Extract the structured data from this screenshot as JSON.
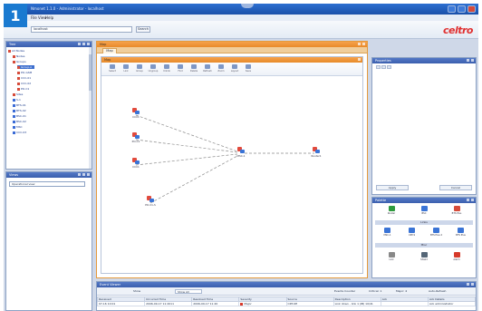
{
  "step_badge": "1",
  "app": {
    "title": "Nmonet 1.1.0 - Administrator - localhost"
  },
  "menu": [
    "File",
    "View",
    "Help"
  ],
  "toolbar": {
    "session_value": "localhost",
    "go_label": "Search",
    "brand": "celtro"
  },
  "left_tree": {
    "title": "Tree",
    "items": [
      {
        "label": "All Nodes",
        "level": 0,
        "icon": "folder-icon"
      },
      {
        "label": "Nodes",
        "level": 1,
        "icon": "folder-icon"
      },
      {
        "label": "Groups",
        "level": 1,
        "icon": "folder-icon"
      },
      {
        "label": "Group-A",
        "level": 2,
        "icon": "node-icon"
      },
      {
        "label": "PO-GSM",
        "level": 2,
        "icon": "node-icon"
      },
      {
        "label": "CCC-01",
        "level": 2,
        "icon": "node-icon"
      },
      {
        "label": "CCC-02",
        "level": 2,
        "icon": "node-icon"
      },
      {
        "label": "PO-C1",
        "level": 2,
        "icon": "node-icon"
      },
      {
        "label": "Sites",
        "level": 1,
        "icon": "folder-icon"
      },
      {
        "label": "S-1",
        "level": 1,
        "icon": "node-icon"
      },
      {
        "label": "BTS-01",
        "level": 1,
        "icon": "node-icon"
      },
      {
        "label": "BTS-02",
        "level": 1,
        "icon": "node-icon"
      },
      {
        "label": "BSC-01",
        "level": 1,
        "icon": "node-icon"
      },
      {
        "label": "BSC-02",
        "level": 1,
        "icon": "node-icon"
      },
      {
        "label": "MSC",
        "level": 1,
        "icon": "node-icon"
      },
      {
        "label": "CCC-03",
        "level": 1,
        "icon": "node-icon"
      }
    ]
  },
  "views_panel": {
    "title": "Views",
    "selected": "Operational view"
  },
  "map_panel": {
    "title": "Map",
    "tab": "Map",
    "inner_title": "Map",
    "tools": [
      "Select",
      "Link",
      "Group",
      "Ungroup",
      "Unlink",
      "Find",
      "Delete",
      "Refresh",
      "Zoom",
      "Layout",
      "Save"
    ]
  },
  "topology": {
    "nodes": [
      {
        "id": "n1",
        "label": "CCC1"
      },
      {
        "id": "n2",
        "label": "PO-C1"
      },
      {
        "id": "n3",
        "label": "CCC1"
      },
      {
        "id": "n4",
        "label": "PO-C1-S"
      },
      {
        "id": "hub",
        "label": "MSC-1"
      },
      {
        "id": "sw",
        "label": "Router1"
      }
    ],
    "links": [
      [
        "n1",
        "hub"
      ],
      [
        "n2",
        "hub"
      ],
      [
        "n3",
        "hub"
      ],
      [
        "n4",
        "hub"
      ],
      [
        "hub",
        "sw"
      ]
    ]
  },
  "properties_panel": {
    "title": "Properties",
    "apply_label": "Apply",
    "cancel_label": "Cancel"
  },
  "palette_panel": {
    "title": "Palette",
    "rows": [
      [
        {
          "label": "Router",
          "color": "#2e9a3e"
        },
        {
          "label": "BSC",
          "color": "#3a74d6"
        },
        {
          "label": "BTS Plus",
          "color": "#d64b3a"
        }
      ],
      [
        {
          "label": "MSC-1",
          "color": "#3a74d6"
        },
        {
          "label": "CRT-9",
          "color": "#3a74d6"
        },
        {
          "label": "BTS Plus 2",
          "color": "#3a74d6"
        },
        {
          "label": "BTS Plus",
          "color": "#3a74d6"
        }
      ],
      [
        {
          "label": "Link",
          "color": "#888888"
        },
        {
          "label": "Shield",
          "color": "#556677"
        },
        {
          "label": "Alarm",
          "color": "#d63a2a"
        }
      ]
    ],
    "section_links": "Links",
    "section_misc": "Misc"
  },
  "events_panel": {
    "title": "Event Viewer",
    "filter_label": "Show",
    "filter_value": "Show All",
    "counter_label": "Events Counter",
    "critical": "Critical: 1",
    "major": "Major: 4",
    "refresh": "Auto-Refresh",
    "columns": [
      "Received",
      "Occurred Time",
      "Resolved Time",
      "Severity",
      "Source",
      "Description",
      "Ack",
      "Ack Details"
    ],
    "rows": [
      [
        "07-16 10:01",
        "2006-09-17 11:2011",
        "2006-09-17 11:20",
        "Major",
        "CRT-9H",
        "Link down - link 1 (IB) 10/41",
        "",
        "Ack administrator"
      ]
    ]
  }
}
